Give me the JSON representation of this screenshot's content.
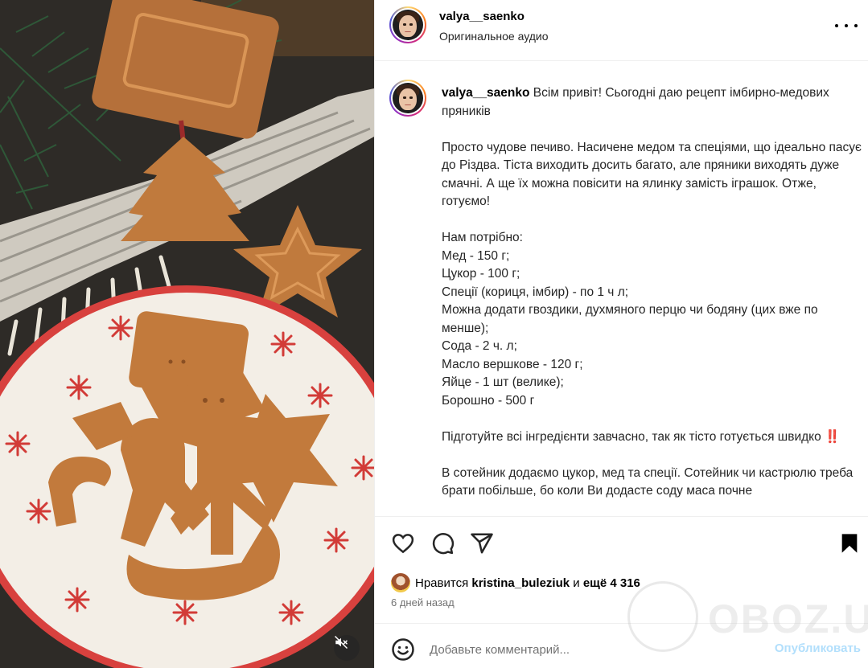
{
  "media": {
    "alt_icons": [
      "speaker-muted-icon"
    ]
  },
  "header": {
    "username": "valya__saenko",
    "audio": "Оригинальное аудио"
  },
  "caption": {
    "username": "valya__saenko",
    "intro": "Всім привіт! Сьогодні даю рецепт імбирно-медових пряників",
    "para1": "Просто чудове печиво. Насичене медом та спеціями, що ідеально пасує до Різдва. Тіста виходить досить багато, але пряники виходять дуже смачні. А ще їх можна повісити на ялинку замість іграшок. Отже, готуємо!",
    "ingredients_title": "Нам потрібно:",
    "ingredients": [
      "Мед - 150 г;",
      "Цукор - 100 г;",
      "Спеції (кориця, імбир) - по 1 ч л;",
      "Можна додати гвоздики, духмяного перцю чи бодяну (цих вже по менше);",
      "Сода - 2 ч. л;",
      "Масло вершкове - 120 г;",
      "Яйце - 1 шт (велике);",
      "Борошно - 500 г"
    ],
    "prep": "Підготуйте всі інгредієнти завчасно, так як тісто готується швидко",
    "prep_emoji": "‼️",
    "step1": "В сотейник додаємо цукор, мед та спеції. Сотейник чи кастрюлю треба брати побільше, бо коли Ви додасте соду маса почне"
  },
  "likes": {
    "prefix": "Нравится",
    "user": "kristina_buleziuk",
    "conj": "и",
    "more": "ещё 4 316"
  },
  "date": "6 дней назад",
  "comment": {
    "placeholder": "Добавьте комментарий...",
    "post_label": "Опубликовать"
  },
  "watermark": {
    "text": "OBOZ.UA"
  },
  "colors": {
    "link_disabled": "#b2dffc",
    "meta_gray": "#737373"
  }
}
